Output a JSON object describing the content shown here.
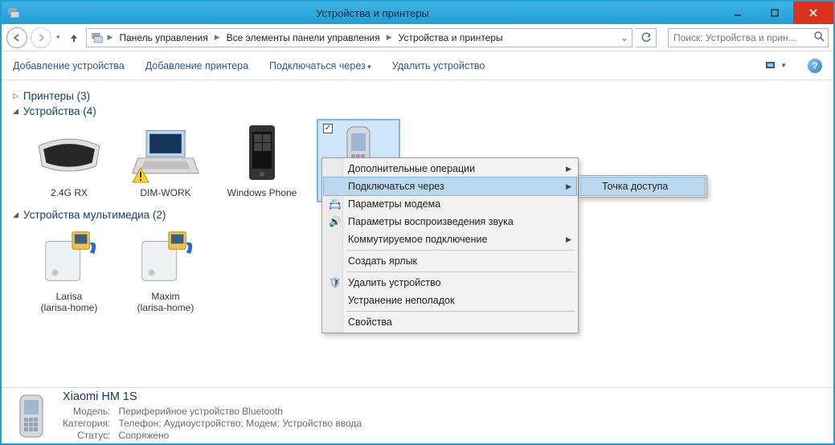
{
  "window": {
    "title": "Устройства и принтеры"
  },
  "breadcrumb": {
    "items": [
      "Панель управления",
      "Все элементы панели управления",
      "Устройства и принтеры"
    ]
  },
  "search": {
    "placeholder": "Поиск: Устройства и прин..."
  },
  "commandbar": {
    "add_device": "Добавление устройства",
    "add_printer": "Добавление принтера",
    "connect_via": "Подключаться через",
    "remove_device": "Удалить устройство"
  },
  "groups": {
    "printers": {
      "label": "Принтеры (3)",
      "expanded": false
    },
    "devices": {
      "label": "Устройства (4)",
      "expanded": true,
      "items": [
        {
          "name": "2.4G RX"
        },
        {
          "name": "DIM-WORK",
          "warning": true
        },
        {
          "name": "Windows Phone"
        },
        {
          "name": "Xiaomi HM 1S",
          "selected": true
        }
      ]
    },
    "multimedia": {
      "label": "Устройства мультимедиа (2)",
      "expanded": true,
      "items": [
        {
          "name": "Larisa",
          "sub": "(larisa-home)"
        },
        {
          "name": "Maxim",
          "sub": "(larisa-home)"
        }
      ]
    }
  },
  "context_menu": {
    "items": {
      "advanced": "Дополнительные операции",
      "connect_via": "Подключаться через",
      "modem_params": "Параметры модема",
      "audio_params": "Параметры воспроизведения звука",
      "dialup": "Коммутируемое подключение",
      "shortcut": "Создать ярлык",
      "remove": "Удалить устройство",
      "troubleshoot": "Устранение неполадок",
      "properties": "Свойства"
    },
    "submenu": {
      "access_point": "Точка доступа"
    }
  },
  "details": {
    "name": "Xiaomi HM 1S",
    "labels": {
      "model": "Модель:",
      "category": "Категория:",
      "status": "Статус:"
    },
    "model": "Периферийное устройство Bluetooth",
    "category": "Телефон; Аудиоустройство; Модем; Устройство ввода",
    "status": "Сопряжено"
  }
}
